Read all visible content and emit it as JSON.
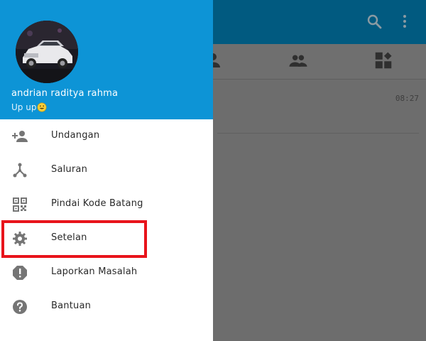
{
  "app": {
    "toolbar_icons": [
      "search-icon",
      "more-vert-icon"
    ],
    "tabs": [
      {
        "icon": "person-icon"
      },
      {
        "icon": "group-icon"
      },
      {
        "icon": "dashboard-icon"
      }
    ],
    "chat_list": [
      {
        "time": "08:27"
      }
    ]
  },
  "drawer": {
    "profile": {
      "name": "andrian raditya rahma",
      "status": "Up up",
      "status_emoji": "grin-emoji-icon"
    },
    "menu": [
      {
        "label": "Undangan",
        "icon": "person-add-icon"
      },
      {
        "label": "Saluran",
        "icon": "channel-icon"
      },
      {
        "label": "Pindai Kode Batang",
        "icon": "qr-code-icon"
      },
      {
        "label": "Setelan",
        "icon": "settings-icon",
        "highlighted": true
      },
      {
        "label": "Laporkan Masalah",
        "icon": "report-icon"
      },
      {
        "label": "Bantuan",
        "icon": "help-icon"
      }
    ]
  },
  "colors": {
    "drawer_header": "#0d94d6",
    "toolbar_dimmed": "#015a80",
    "highlight": "#e8141b",
    "menu_icon": "#757575"
  }
}
